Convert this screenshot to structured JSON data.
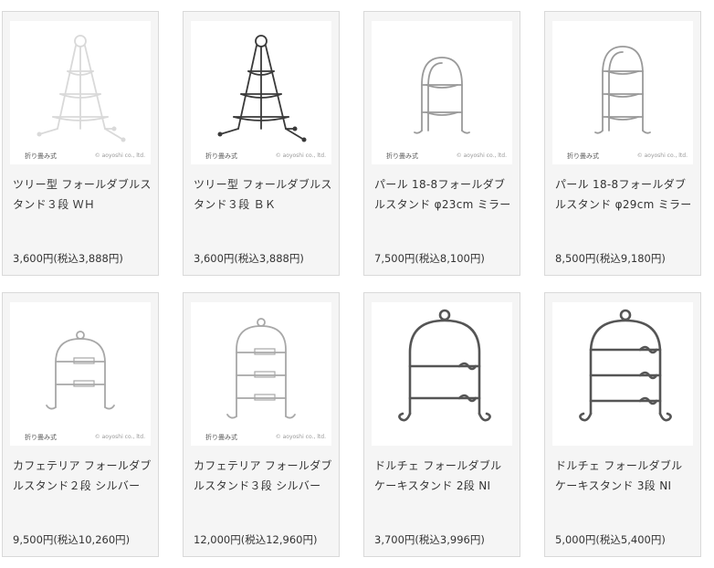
{
  "products": [
    {
      "name": "ツリー型 フォールダブルスタンド３段 ＷＨ",
      "price": "3,600円(税込3,888円)",
      "fold_label": "折り畳み式",
      "copyright": "© aoyoshi co., ltd.",
      "style": "tree",
      "color": "#d9d9d9"
    },
    {
      "name": "ツリー型 フォールダブルスタンド３段 ＢＫ",
      "price": "3,600円(税込3,888円)",
      "fold_label": "折り畳み式",
      "copyright": "© aoyoshi co., ltd.",
      "style": "tree",
      "color": "#3a3a3a"
    },
    {
      "name": "パール 18-8フォールダブルスタンド φ23cm ミラー",
      "price": "7,500円(税込8,100円)",
      "fold_label": "折り畳み式",
      "copyright": "© aoyoshi co., ltd.",
      "style": "arch2",
      "color": "#9a9a9a"
    },
    {
      "name": "パール 18-8フォールダブルスタンド φ29cm ミラー",
      "price": "8,500円(税込9,180円)",
      "fold_label": "折り畳み式",
      "copyright": "© aoyoshi co., ltd.",
      "style": "arch3",
      "color": "#9a9a9a"
    },
    {
      "name": "カフェテリア フォールダブルスタンド２段 シルバー",
      "price": "9,500円(税込10,260円)",
      "fold_label": "折り畳み式",
      "copyright": "© aoyoshi co., ltd.",
      "style": "cafe2",
      "color": "#a8a8a8"
    },
    {
      "name": "カフェテリア フォールダブルスタンド３段 シルバー",
      "price": "12,000円(税込12,960円)",
      "fold_label": "折り畳み式",
      "copyright": "© aoyoshi co., ltd.",
      "style": "cafe3",
      "color": "#a8a8a8"
    },
    {
      "name": "ドルチェ フォールダブル ケーキスタンド 2段 NI",
      "price": "3,700円(税込3,996円)",
      "fold_label": "",
      "copyright": "",
      "style": "dolce2",
      "color": "#555555"
    },
    {
      "name": "ドルチェ フォールダブル ケーキスタンド 3段 NI",
      "price": "5,000円(税込5,400円)",
      "fold_label": "",
      "copyright": "",
      "style": "dolce3",
      "color": "#555555"
    }
  ]
}
